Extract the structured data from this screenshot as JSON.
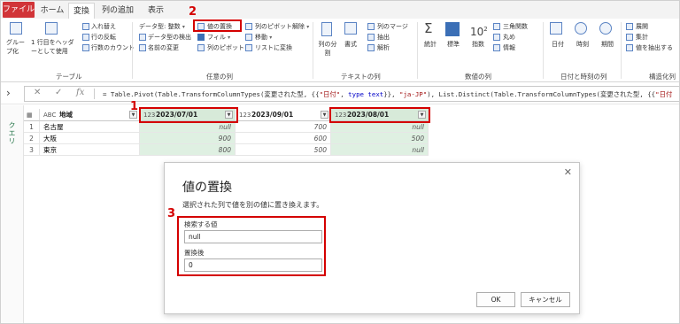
{
  "tabs": [
    "ファイル",
    "ホーム",
    "変換",
    "列の追加",
    "表示"
  ],
  "ribbon": {
    "group": "グループ化",
    "first_row": "1 行目をヘッダーとして使用",
    "transpose": "入れ替え",
    "reverse": "行の反転",
    "count_rows": "行数のカウント",
    "data_type": "データ型: 整数",
    "detect_type": "データ型の検出",
    "rename": "名前の変更",
    "replace_values": "値の置換",
    "fill": "フィル",
    "pivot": "列のピボット",
    "unpivot": "列のピボット解除",
    "move": "移動",
    "to_list": "リストに変換",
    "split": "列の分割",
    "format": "書式",
    "merge_cols": "列のマージ",
    "extract": "抽出",
    "parse": "解析",
    "stats": "統計",
    "standard": "標準",
    "scientific": "指数",
    "trig": "三角関数",
    "rounding": "丸め",
    "info": "情報",
    "date": "日付",
    "time": "時刻",
    "duration": "期間",
    "expand": "展開",
    "aggregate": "集計",
    "extract_values": "値を抽出する",
    "groups": [
      "テーブル",
      "任意の列",
      "テキストの列",
      "数値の列",
      "日付と時刻の列",
      "構造化列"
    ]
  },
  "formula": {
    "p1": "= Table.Pivot(Table.TransformColumnTypes(変更された型, {{",
    "s1": "\"日付\"",
    "p2": ", ",
    "k1": "type text",
    "p3": "}}, ",
    "s2": "\"ja-JP\"",
    "p4": "), List.Distinct(Table.TransformColumnTypes(変更された型, {{",
    "s3": "\"日付"
  },
  "query_pane_label": "クエリ",
  "table": {
    "headers": [
      {
        "type": "ABC",
        "label": "地域"
      },
      {
        "type": "123",
        "label": "2023/07/01"
      },
      {
        "type": "123",
        "label": "2023/09/01"
      },
      {
        "type": "123",
        "label": "2023/08/01"
      }
    ],
    "rows": [
      {
        "n": "1",
        "region": "名古屋",
        "c1": "null",
        "c2": "700",
        "c3": "null"
      },
      {
        "n": "2",
        "region": "大阪",
        "c1": "900",
        "c2": "600",
        "c3": "500"
      },
      {
        "n": "3",
        "region": "東京",
        "c1": "800",
        "c2": "500",
        "c3": "null"
      }
    ]
  },
  "markers": [
    "1",
    "2",
    "3"
  ],
  "dialog": {
    "title": "値の置換",
    "description": "選択された列で値を別の値に置き換えます。",
    "find_label": "検索する値",
    "find_value": "null",
    "replace_label": "置換後",
    "replace_value": "0",
    "ok": "OK",
    "cancel": "キャンセル"
  },
  "colors": {
    "file_tab": "#d13438",
    "selected_column": "#dff0e2",
    "annotation": "#d40000",
    "query_label": "#217346"
  }
}
